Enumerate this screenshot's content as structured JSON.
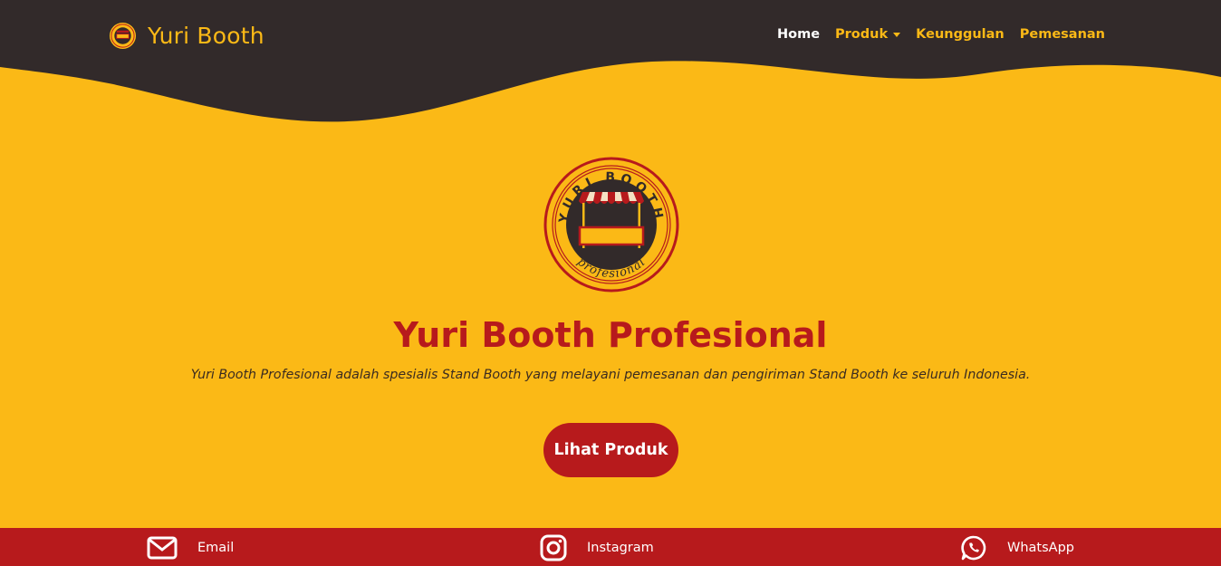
{
  "colors": {
    "background": "#fbb916",
    "dark": "#322a2a",
    "brand_red": "#b71a1c",
    "nav_text": "#fbb916",
    "nav_active": "#ffffff"
  },
  "navbar": {
    "brand": "Yuri Booth",
    "brand_icon": "yuri-booth-logo",
    "links": {
      "home": "Home",
      "produk": "Produk",
      "keunggulan": "Keunggulan",
      "pemesanan": "Pemesanan"
    }
  },
  "hero": {
    "logo": {
      "top_text": "YURI BOOTH",
      "bottom_text": "profesional"
    },
    "title": "Yuri Booth Profesional",
    "description": "Yuri Booth Profesional adalah spesialis Stand Booth yang melayani pemesanan dan pengiriman Stand Booth ke seluruh Indonesia.",
    "cta": "Lihat Produk"
  },
  "footer": {
    "email": {
      "label": "Email",
      "icon": "envelope-icon"
    },
    "instagram": {
      "label": "Instagram",
      "icon": "instagram-icon"
    },
    "whatsapp": {
      "label": "WhatsApp",
      "icon": "whatsapp-icon"
    }
  }
}
